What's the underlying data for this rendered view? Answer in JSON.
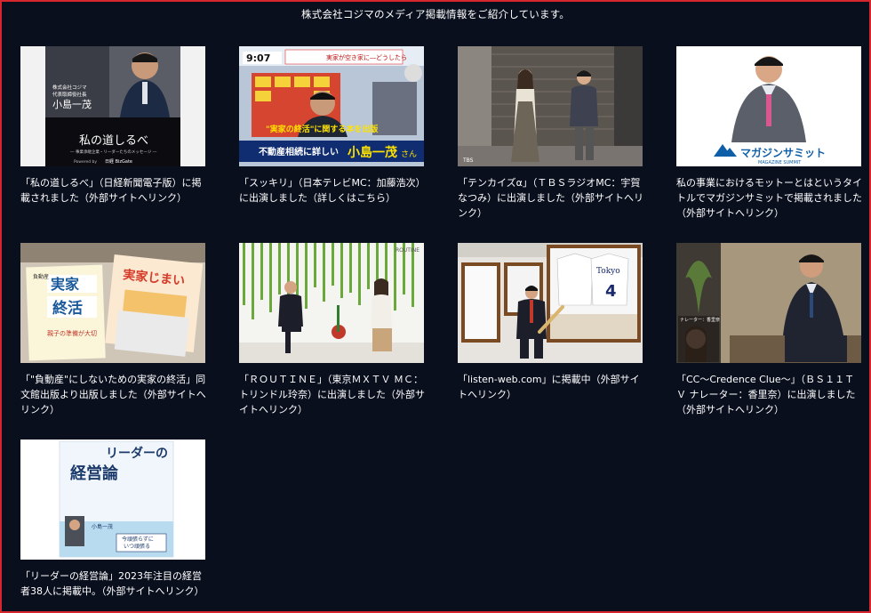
{
  "intro": "株式会社コジマのメディア掲載情報をご紹介しています。",
  "cards": [
    {
      "caption": "「私の道しるべ」（日経新聞電子版）に掲載されました（外部サイトへリンク）",
      "thumb": {
        "lines": [
          "株式会社コジマ",
          "代表取締役社長"
        ],
        "name": "小島一茂",
        "title": "私の道しるべ",
        "subtitle": "― 事業承継企業・リーダーたちのメッセージ ―",
        "powered": "Powered by",
        "brand": "日経 BizGate"
      }
    },
    {
      "caption": "「スッキリ」（日本テレビMC：加藤浩次）に出演しました（詳しくはこちら）",
      "thumb": {
        "time": "9:07",
        "ticker": "実家が空き家に―どうしたら",
        "headline1": "\"実家の終活\"に関する本を出版",
        "headline2": "不動産相続に詳しい",
        "name": "小島一茂",
        "suffix": "さん"
      }
    },
    {
      "caption": "「テンカイズα」（ＴＢＳラジオMC：宇賀なつみ）に出演しました（外部サイトへリンク）",
      "thumb": {
        "logo": "TBS"
      }
    },
    {
      "caption": "私の事業におけるモットーとはというタイトルでマガジンサミットで掲載されました（外部サイトへリンク）",
      "thumb": {
        "logo": "マガジンサミット",
        "sub": "MAGAZINE SUMMIT"
      }
    },
    {
      "caption": "「\"負動産\"にしないための実家の終活」同文館出版より出版しました（外部サイトへリンク）",
      "thumb": {
        "book1": "実家",
        "book2": "終活",
        "book3": "実家じまい",
        "pre": "負動産",
        "sub": "親子の準備が大切"
      }
    },
    {
      "caption": "「ＲＯＵＴＩＮＥ」（東京ＭＸＴＶ ＭＣ：トリンドル玲奈）に出演しました（外部サイトへリンク）",
      "thumb": {
        "logo": "ROUTINE"
      }
    },
    {
      "caption": "「listen-web.com」に掲載中（外部サイトへリンク）",
      "thumb": {
        "jersey": "Tokyo",
        "num": "4"
      }
    },
    {
      "caption": "「CC～Credence Clue～」（ＢＳ１１ＴＶ ナレーター：香里奈）に出演しました（外部サイトへリンク）",
      "thumb": {
        "label": "ナレーター：香里奈"
      }
    },
    {
      "caption": "「リーダーの経営論」2023年注目の経営者38人に掲載中。（外部サイトへリンク）",
      "thumb": {
        "title1": "リーダーの",
        "title2": "経営論",
        "tag1": "今頑張らずに",
        "tag2": "いつ頑張る",
        "author": "小島一茂"
      }
    }
  ],
  "colors": {
    "background": "#0a0f1e",
    "border": "#d8262e",
    "text": "#ffffff"
  }
}
